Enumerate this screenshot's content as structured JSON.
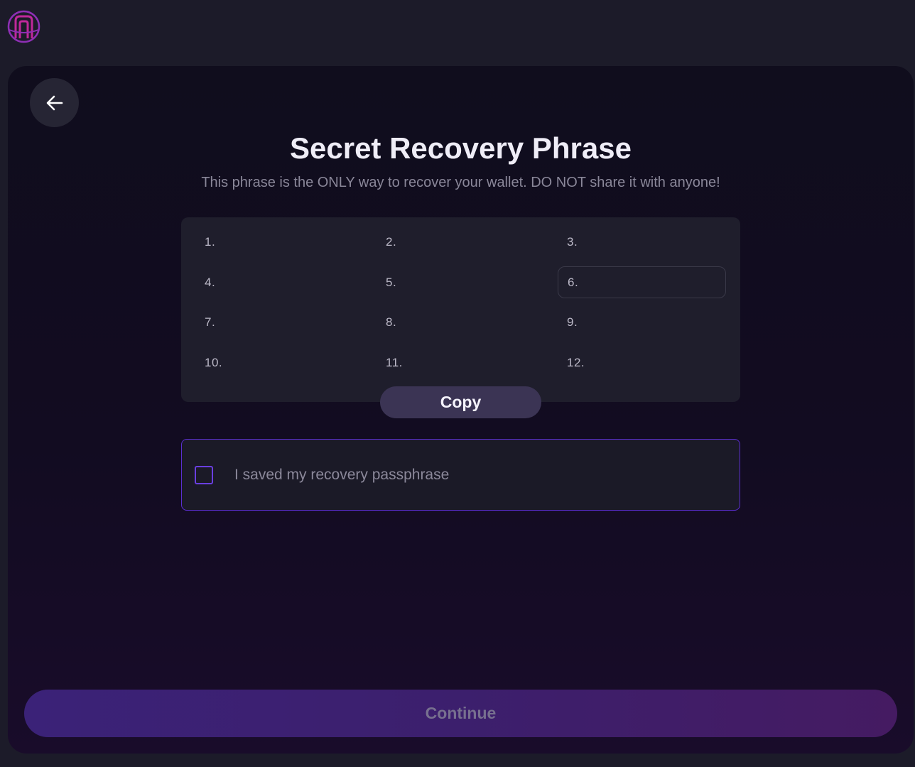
{
  "header": {
    "logo_icon": "portal-arch-logo-icon"
  },
  "back_button": {
    "icon": "arrow-left-icon"
  },
  "title": "Secret Recovery Phrase",
  "subtitle": "This phrase is the ONLY way to recover your wallet. DO NOT share it with anyone!",
  "words": [
    {
      "num": "1.",
      "value": ""
    },
    {
      "num": "2.",
      "value": ""
    },
    {
      "num": "3.",
      "value": ""
    },
    {
      "num": "4.",
      "value": ""
    },
    {
      "num": "5.",
      "value": ""
    },
    {
      "num": "6.",
      "value": ""
    },
    {
      "num": "7.",
      "value": ""
    },
    {
      "num": "8.",
      "value": ""
    },
    {
      "num": "9.",
      "value": ""
    },
    {
      "num": "10.",
      "value": ""
    },
    {
      "num": "11.",
      "value": ""
    },
    {
      "num": "12.",
      "value": ""
    }
  ],
  "copy_label": "Copy",
  "confirm": {
    "label": "I saved my recovery passphrase",
    "checked": false
  },
  "continue_label": "Continue",
  "colors": {
    "accent": "#6a3fe0",
    "background": "#1c1b29",
    "panel": "#100d1d",
    "continue_button": "#3c1f6d"
  }
}
